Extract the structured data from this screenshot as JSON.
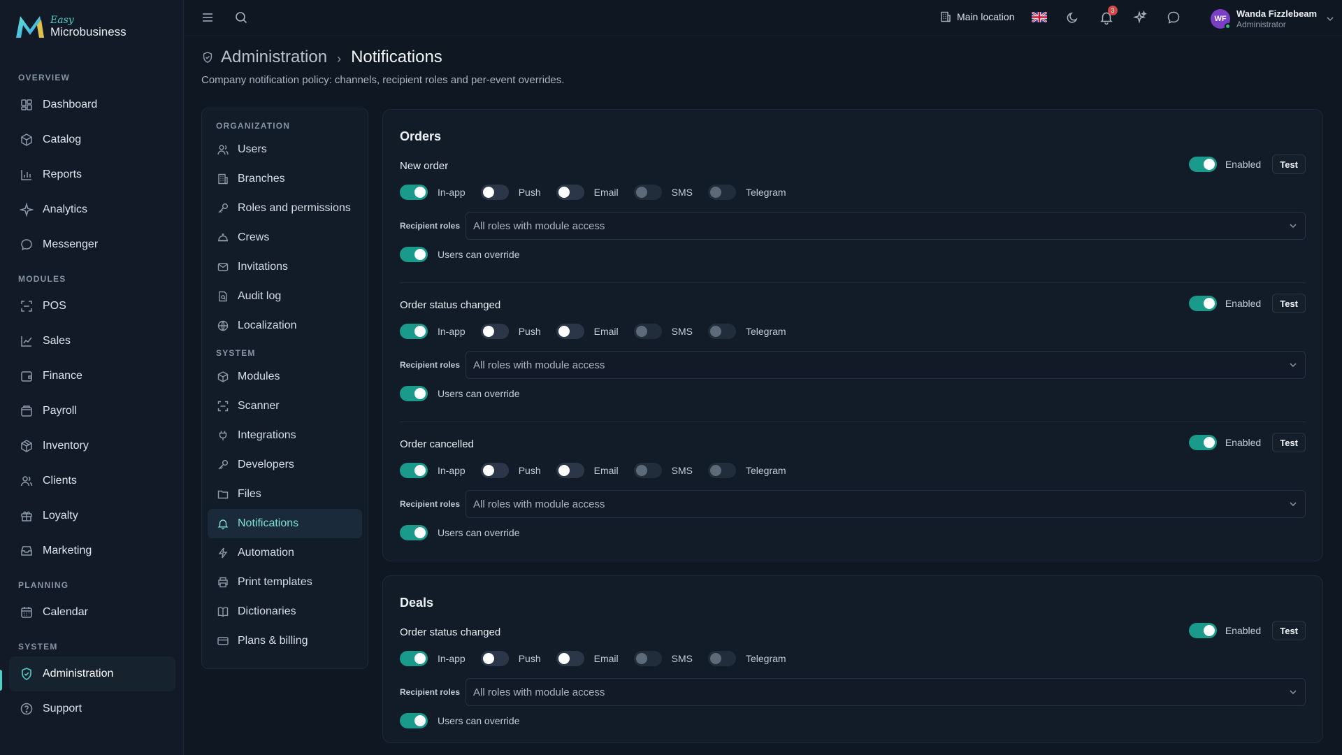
{
  "brand": {
    "line1": "Easy",
    "line2": "Microbusiness"
  },
  "sidebar": {
    "sections": [
      {
        "label": "OVERVIEW",
        "items": [
          {
            "label": "Dashboard",
            "icon": "dashboard-icon"
          },
          {
            "label": "Catalog",
            "icon": "catalog-icon"
          },
          {
            "label": "Reports",
            "icon": "reports-icon"
          },
          {
            "label": "Analytics",
            "icon": "analytics-icon"
          },
          {
            "label": "Messenger",
            "icon": "messenger-icon"
          }
        ]
      },
      {
        "label": "MODULES",
        "items": [
          {
            "label": "POS",
            "icon": "pos-icon"
          },
          {
            "label": "Sales",
            "icon": "sales-icon"
          },
          {
            "label": "Finance",
            "icon": "finance-icon"
          },
          {
            "label": "Payroll",
            "icon": "payroll-icon"
          },
          {
            "label": "Inventory",
            "icon": "inventory-icon"
          },
          {
            "label": "Clients",
            "icon": "clients-icon"
          },
          {
            "label": "Loyalty",
            "icon": "loyalty-icon"
          },
          {
            "label": "Marketing",
            "icon": "marketing-icon"
          }
        ]
      },
      {
        "label": "PLANNING",
        "items": [
          {
            "label": "Calendar",
            "icon": "calendar-icon"
          }
        ]
      },
      {
        "label": "SYSTEM",
        "items": [
          {
            "label": "Administration",
            "icon": "shield-icon",
            "active": true
          },
          {
            "label": "Support",
            "icon": "help-icon"
          }
        ]
      }
    ]
  },
  "topbar": {
    "location": "Main location",
    "notification_count": "3",
    "user": {
      "initials": "WF",
      "name": "Wanda Fizzlebeam",
      "role": "Administrator"
    }
  },
  "header": {
    "parent": "Administration",
    "current": "Notifications",
    "subtitle": "Company notification policy: channels, recipient roles and per-event overrides."
  },
  "subnav": {
    "sections": [
      {
        "label": "ORGANIZATION",
        "items": [
          {
            "label": "Users",
            "icon": "users-icon"
          },
          {
            "label": "Branches",
            "icon": "branches-icon"
          },
          {
            "label": "Roles and permissions",
            "icon": "key-icon"
          },
          {
            "label": "Crews",
            "icon": "crews-icon"
          },
          {
            "label": "Invitations",
            "icon": "mail-icon"
          },
          {
            "label": "Audit log",
            "icon": "audit-icon"
          },
          {
            "label": "Localization",
            "icon": "globe-icon"
          }
        ]
      },
      {
        "label": "SYSTEM",
        "items": [
          {
            "label": "Modules",
            "icon": "modules-icon"
          },
          {
            "label": "Scanner",
            "icon": "scanner-icon"
          },
          {
            "label": "Integrations",
            "icon": "plug-icon"
          },
          {
            "label": "Developers",
            "icon": "key-icon"
          },
          {
            "label": "Files",
            "icon": "folder-icon"
          },
          {
            "label": "Notifications",
            "icon": "bell-icon",
            "active": true
          },
          {
            "label": "Automation",
            "icon": "bolt-icon"
          },
          {
            "label": "Print templates",
            "icon": "printer-icon"
          },
          {
            "label": "Dictionaries",
            "icon": "book-icon"
          },
          {
            "label": "Plans & billing",
            "icon": "card-icon"
          }
        ]
      }
    ]
  },
  "labels": {
    "enabled": "Enabled",
    "test": "Test",
    "recipient_roles": "Recipient roles",
    "users_can_override": "Users can override"
  },
  "channel_names": [
    "In-app",
    "Push",
    "Email",
    "SMS",
    "Telegram"
  ],
  "groups": [
    {
      "title": "Orders",
      "events": [
        {
          "name": "New order",
          "enabled": true,
          "channels": [
            "on",
            "off",
            "off",
            "disabled",
            "disabled"
          ],
          "roles": "All roles with module access",
          "override": true
        },
        {
          "name": "Order status changed",
          "enabled": true,
          "channels": [
            "on",
            "off",
            "off",
            "disabled",
            "disabled"
          ],
          "roles": "All roles with module access",
          "override": true
        },
        {
          "name": "Order cancelled",
          "enabled": true,
          "channels": [
            "on",
            "off",
            "off",
            "disabled",
            "disabled"
          ],
          "roles": "All roles with module access",
          "override": true
        }
      ]
    },
    {
      "title": "Deals",
      "events": [
        {
          "name": "Order status changed",
          "enabled": true,
          "channels": [
            "on",
            "off",
            "off",
            "disabled",
            "disabled"
          ],
          "roles": "All roles with module access",
          "override": true
        }
      ]
    }
  ]
}
